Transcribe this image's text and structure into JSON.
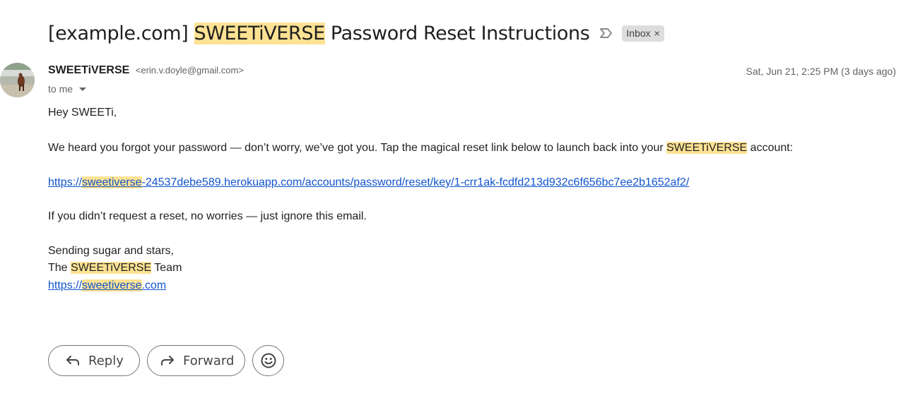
{
  "subject": {
    "prefix": "[example.com] ",
    "brand": "SWEETiVERSE",
    "suffix": " Password Reset Instructions",
    "label_chip": "Inbox",
    "label_remove": "×"
  },
  "sender": {
    "name": "SWEETiVERSE",
    "email": "<erin.v.doyle@gmail.com>",
    "date": "Sat, Jun 21, 2:25 PM (3 days ago)",
    "recipient": "to me"
  },
  "body": {
    "greeting": "Hey SWEETi,",
    "para1_before": "We heard you forgot your password — don’t worry, we’ve got you. Tap the magical reset link below to launch back into your ",
    "para1_brand": "SWEETiVERSE",
    "para1_after": " account:",
    "reset_link_prefix": "https://",
    "reset_link_highlight": "sweetiverse",
    "reset_link_suffix": "-24537debe589.herokuapp.com/accounts/password/reset/key/1-crr1ak-fcdfd213d932c6f656bc7ee2b1652af2/",
    "para2": "If you didn’t request a reset, no worries — just ignore this email.",
    "signoff": "Sending sugar and stars,",
    "team_before": "The ",
    "team_brand": "SWEETiVERSE",
    "team_after": " Team",
    "site_link_prefix": "https://",
    "site_link_highlight": "sweetiverse",
    "site_link_suffix": ".com"
  },
  "actions": {
    "reply": "Reply",
    "forward": "Forward"
  },
  "icons": {
    "importance": "importance-marker-icon",
    "reply": "reply-arrow-icon",
    "forward": "forward-arrow-icon",
    "emoji": "smiley-icon",
    "caret": "caret-down-icon"
  },
  "colors": {
    "highlight": "#fde293",
    "link": "#1155cc"
  }
}
